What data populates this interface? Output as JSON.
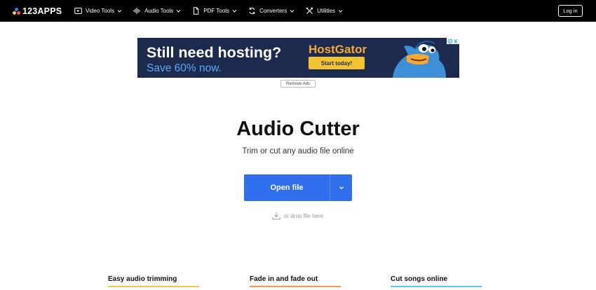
{
  "header": {
    "logo_text": "123APPS",
    "nav": [
      {
        "label": "Video Tools",
        "icon": "video-icon"
      },
      {
        "label": "Audio Tools",
        "icon": "audio-wave-icon"
      },
      {
        "label": "PDF Tools",
        "icon": "pdf-file-icon"
      },
      {
        "label": "Converters",
        "icon": "converter-icon"
      },
      {
        "label": "Utilities",
        "icon": "utilities-icon"
      }
    ],
    "login_label": "Log in"
  },
  "ad": {
    "headline": "Still need hosting?",
    "subline": "Save 60% now.",
    "brand": "HostGator",
    "cta": "Start today!",
    "remove_ads_label": "Remove Ads"
  },
  "main": {
    "title": "Audio Cutter",
    "subtitle": "Trim or cut any audio file online",
    "open_button_label": "Open file",
    "drop_hint": "or drop file here"
  },
  "features": [
    {
      "title": "Easy audio trimming",
      "accent": "#f2c94c"
    },
    {
      "title": "Fade in and fade out",
      "accent": "#f2994a"
    },
    {
      "title": "Cut songs online",
      "accent": "#56ccf2"
    }
  ],
  "colors": {
    "primary_button": "#2f6fed",
    "topbar": "#000000",
    "ad_background": "#1c2a4d"
  }
}
